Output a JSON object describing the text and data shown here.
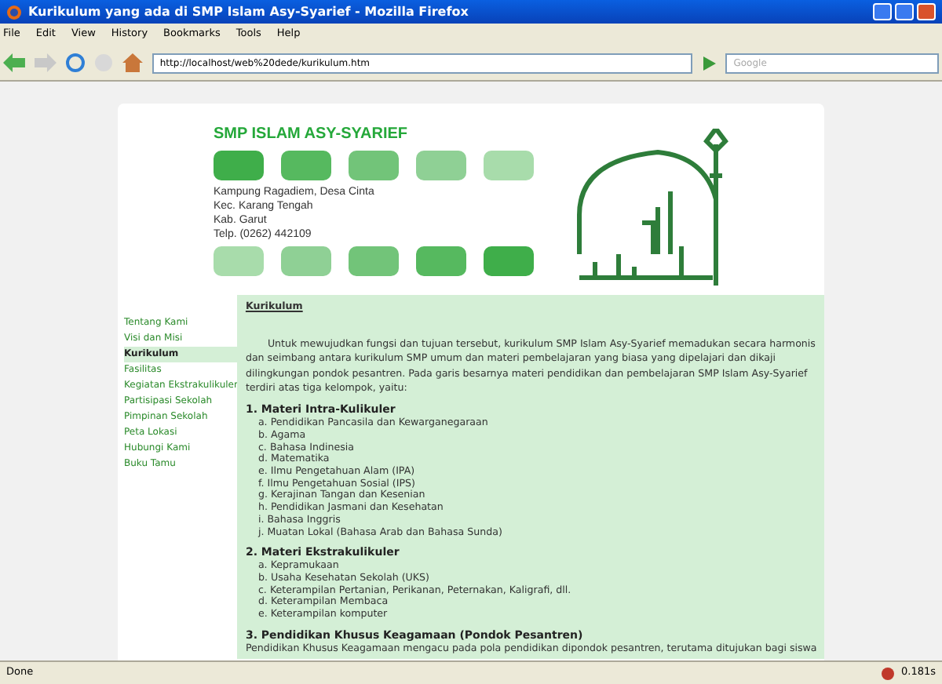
{
  "window": {
    "title": "Kurikulum yang ada di SMP Islam Asy-Syarief - Mozilla Firefox"
  },
  "menu": [
    "File",
    "Edit",
    "View",
    "History",
    "Bookmarks",
    "Tools",
    "Help"
  ],
  "address": {
    "value": "http://localhost/web%20dede/kurikulum.htm"
  },
  "search": {
    "placeholder": "Google"
  },
  "header": {
    "school_name": "SMP ISLAM ASY-SYARIEF",
    "squares_top": [
      {
        "color": "#3fae4a"
      },
      {
        "color": "#56b95f"
      },
      {
        "color": "#72c479"
      },
      {
        "color": "#8fd095"
      },
      {
        "color": "#a8dcab"
      }
    ],
    "address_lines": [
      "Kampung Ragadiem, Desa Cinta",
      "Kec. Karang Tengah",
      "Kab. Garut",
      "Telp. (0262) 442109"
    ],
    "squares_bottom": [
      {
        "color": "#a8dcab"
      },
      {
        "color": "#8fd095"
      },
      {
        "color": "#72c479"
      },
      {
        "color": "#56b95f"
      },
      {
        "color": "#3fae4a"
      }
    ]
  },
  "sidebar": {
    "items": [
      {
        "label": "Tentang Kami",
        "selected": false
      },
      {
        "label": "Visi dan Misi",
        "selected": false
      },
      {
        "label": "Kurikulum",
        "selected": true
      },
      {
        "label": "Fasilitas",
        "selected": false
      },
      {
        "label": "Kegiatan Ekstrakulikuler",
        "selected": false
      },
      {
        "label": "Partisipasi Sekolah",
        "selected": false
      },
      {
        "label": "Pimpinan Sekolah",
        "selected": false
      },
      {
        "label": "Peta Lokasi",
        "selected": false
      },
      {
        "label": "Hubungi Kami",
        "selected": false
      },
      {
        "label": "Buku Tamu",
        "selected": false
      }
    ]
  },
  "content": {
    "heading": "Kurikulum",
    "intro": "Untuk mewujudkan fungsi dan tujuan tersebut, kurikulum SMP Islam Asy-Syarief memadukan secara harmonis dan seimbang antara kurikulum SMP umum dan materi pembelajaran yang biasa yang dipelajari dan dikaji dilingkungan pondok pesantren. Pada garis besarnya materi pendidikan dan pembelajaran SMP Islam Asy-Syarief terdiri atas tiga kelompok, yaitu:",
    "sections": [
      {
        "title": "1. Materi Intra-Kulikuler",
        "items": [
          {
            "mark": "a.",
            "text": "Pendidikan Pancasila dan Kewarganegaraan"
          },
          {
            "mark": "b.",
            "text": "Agama"
          },
          {
            "mark": "c.",
            "text": "Bahasa Indinesia"
          },
          {
            "mark": "d.",
            "text": "Matematika"
          },
          {
            "mark": "e.",
            "text": "Ilmu Pengetahuan Alam (IPA)"
          },
          {
            "mark": "f.",
            "text": "Ilmu Pengetahuan Sosial (IPS)"
          },
          {
            "mark": "g.",
            "text": "Kerajinan Tangan dan Kesenian"
          },
          {
            "mark": "h.",
            "text": "Pendidikan Jasmani dan Kesehatan"
          },
          {
            "mark": "i.",
            "text": "Bahasa Inggris"
          },
          {
            "mark": "j.",
            "text": "Muatan Lokal (Bahasa Arab dan Bahasa Sunda)"
          }
        ]
      },
      {
        "title": "2. Materi Ekstrakulikuler",
        "items": [
          {
            "mark": "a.",
            "text": "Kepramukaan"
          },
          {
            "mark": "b.",
            "text": "Usaha Kesehatan Sekolah (UKS)"
          },
          {
            "mark": "c.",
            "text": "Keterampilan Pertanian, Perikanan, Peternakan, Kaligrafi, dll."
          },
          {
            "mark": "d.",
            "text": "Keterampilan Membaca"
          },
          {
            "mark": "e.",
            "text": "Keterampilan komputer"
          }
        ]
      },
      {
        "title": "3. Pendidikan Khusus Keagamaan (Pondok Pesantren)",
        "paragraph": "Pendidikan Khusus Keagamaan mengacu pada pola pendidikan dipondok pesantren, terutama ditujukan bagi siswa"
      }
    ]
  },
  "status_bar": {
    "text": "Done",
    "time": "0.181s"
  }
}
